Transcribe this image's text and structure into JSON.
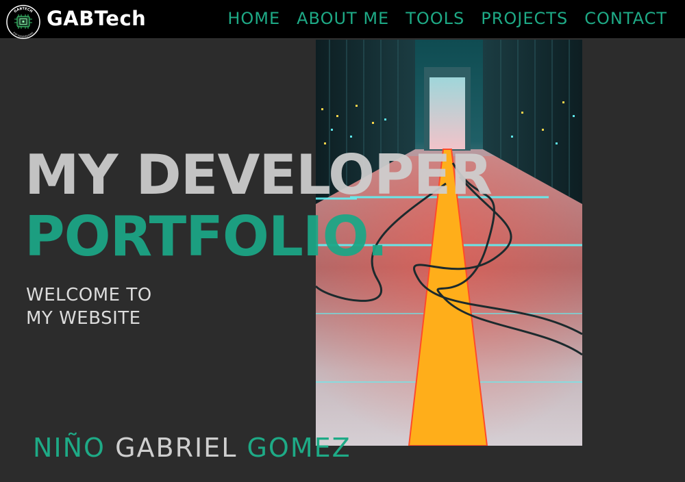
{
  "header": {
    "brand": "GABTech",
    "logo_top_text": "GABTECH",
    "logo_bottom_text": "ESP ENGINEERING",
    "nav": [
      "HOME",
      "ABOUT ME",
      "TOOLS",
      "PROJECTS",
      "CONTACT"
    ]
  },
  "hero": {
    "title_line1": "MY DEVELOPER",
    "title_line2": "PORTFOLIO.",
    "welcome_line1": "WELCOME TO",
    "welcome_line2": "MY WEBSITE",
    "image": "server-room-corridor-illustration"
  },
  "name": {
    "first": "NIÑO",
    "middle": "GABRIEL",
    "last": "GOMEZ"
  },
  "colors": {
    "accent": "#1eaa86",
    "background": "#2c2c2c",
    "nav_bg": "#000000",
    "title": "#cfcfcf"
  }
}
